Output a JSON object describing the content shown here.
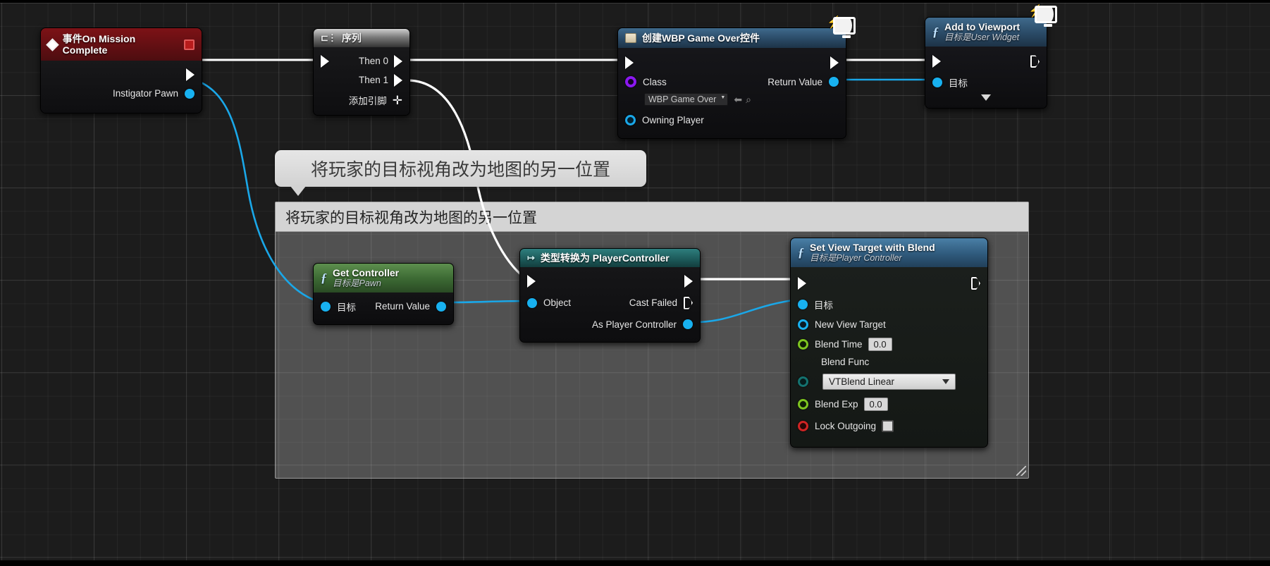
{
  "app": {
    "title": "Blueprint Event Graph"
  },
  "nodes": {
    "event": {
      "title": "事件On Mission Complete",
      "icon": "event-diamond-icon",
      "stop_icon": "event-stop-icon",
      "pins": {
        "exec_out": "",
        "instigator_pawn": "Instigator Pawn"
      }
    },
    "sequence": {
      "title": "序列",
      "icon": "sequence-icon",
      "pins": {
        "then0": "Then 0",
        "then1": "Then 1",
        "add_pin": "添加引脚"
      },
      "add_pin_glyph": "✛"
    },
    "create_widget": {
      "title": "创建WBP Game Over控件",
      "icon": "widget-icon",
      "pins": {
        "class_label": "Class",
        "owning_player": "Owning Player",
        "return_value": "Return Value"
      },
      "class_value": "WBP Game Over",
      "back_icon": "back-arrow-icon",
      "search_icon": "browse-magnifier-icon"
    },
    "add_to_viewport": {
      "title": "Add to Viewport",
      "subtitle": "目标是User Widget",
      "icon": "function-f-icon",
      "pins": {
        "target": "目标"
      },
      "expand_icon": "expand-caret-down-icon"
    },
    "get_controller": {
      "title": "Get Controller",
      "subtitle": "目标是Pawn",
      "icon": "function-f-icon",
      "pins": {
        "target": "目标",
        "return_value": "Return Value"
      }
    },
    "cast": {
      "title": "类型转换为 PlayerController",
      "icon": "cast-icon",
      "pins": {
        "object": "Object",
        "cast_failed": "Cast Failed",
        "as_player_controller": "As Player Controller"
      }
    },
    "set_view_target": {
      "title": "Set View Target with Blend",
      "subtitle": "目标是Player Controller",
      "icon": "function-f-icon",
      "pins": {
        "target": "目标",
        "new_view_target": "New View Target",
        "blend_time": "Blend Time",
        "blend_func": "Blend Func",
        "blend_exp": "Blend Exp",
        "lock_outgoing": "Lock Outgoing"
      },
      "values": {
        "blend_time": "0.0",
        "blend_func": "VTBlend Linear",
        "blend_exp": "0.0",
        "lock_outgoing_checked": false
      }
    }
  },
  "comment_bubble": {
    "text": "将玩家的目标视角改为地图的另一位置"
  },
  "comment_box": {
    "title": "将玩家的目标视角改为地图的另一位置"
  },
  "debug_icons": {
    "create_widget": "debug-monitor-icon",
    "add_to_viewport": "debug-monitor-icon"
  },
  "colors": {
    "exec_wire": "#ffffff",
    "data_wire": "#1aa7e8",
    "event_header": "#7d1216",
    "function_header": "#2f5a7c",
    "pure_function_header": "#3d6b34",
    "cast_header": "#1d5b5b",
    "comment_fill": "#bebebe"
  }
}
